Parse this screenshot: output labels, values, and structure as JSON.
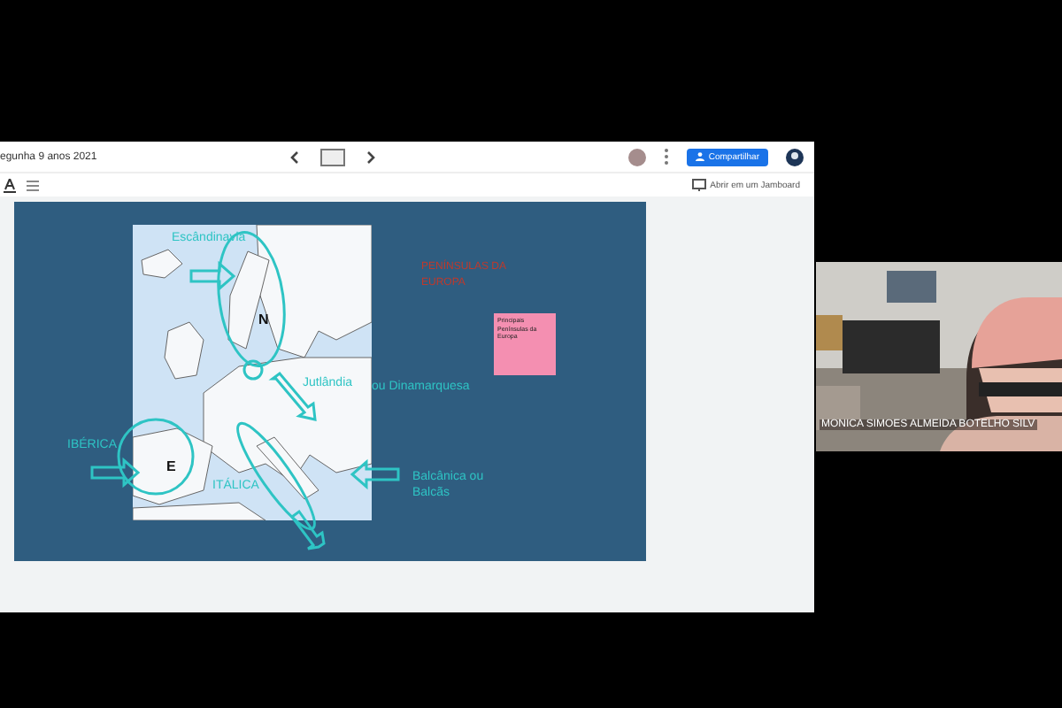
{
  "shared_screen": {
    "document_title": "egunha 9 anos 2021",
    "open_in_jamboard": "Abrir em um Jamboard",
    "share_button": "Compartilhar",
    "slide": {
      "title": "PENÍNSULAS DA EUROPA",
      "sticky_note": "Principais Penínsulas da Europa",
      "map_labels": [
        {
          "text": "Escândinavia",
          "kind": "label"
        },
        {
          "text": "N",
          "kind": "mark"
        },
        {
          "text": "Jutlândia",
          "kind": "label"
        },
        {
          "text": "ou Dinamarquesa",
          "kind": "label"
        },
        {
          "text": "IBÉRICA",
          "kind": "label"
        },
        {
          "text": "E",
          "kind": "mark"
        },
        {
          "text": "ITÁLICA",
          "kind": "label"
        },
        {
          "text": "Balcânica ou Balcãs",
          "kind": "label"
        }
      ]
    }
  },
  "participant": {
    "name": "MONICA SIMOES ALMEIDA BOTELHO SILV"
  }
}
